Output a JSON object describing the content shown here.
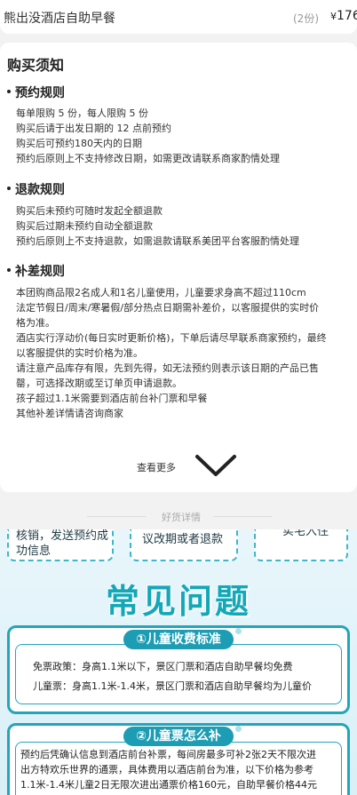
{
  "item": {
    "name": "熊出没酒店自助早餐",
    "count": "(2份)",
    "currency": "¥",
    "price": "176"
  },
  "notice": {
    "title": "购买须知",
    "sections": [
      {
        "title": "预约规则",
        "lines": [
          "每单限购 5 份，每人限购 5 份",
          "购买后请于出发日期的 12 点前预约",
          "购买后可预约180天内的日期",
          "预约后原则上不支持修改日期，如需更改请联系商家酌情处理"
        ]
      },
      {
        "title": "退款规则",
        "lines": [
          "购买后未预约可随时发起全额退款",
          "购买后过期未预约自动全额退款",
          "预约后原则上不支持退款，如需退款请联系美团平台客服酌情处理"
        ]
      },
      {
        "title": "补差规则",
        "lines": [
          "本团购商品限2名成人和1名儿童使用，儿童要求身高不超过110cm",
          "法定节假日/周末/寒暑假/部分热点日期需补差价，以客服提供的实时价",
          "格为准。",
          "酒店实行浮动价(每日实时更新价格)，下单后请尽早联系商家预约，最终",
          "以客服提供的实时价格为准。",
          "请注意产品库存有限，先到先得，如无法预约则表示该日期的产品已售",
          "罄，可选择改期或至订单页申请退款。",
          "孩子超过1.1米需要到酒店前台补门票和早餐",
          "其他补差详情请咨询商家"
        ]
      }
    ],
    "more_label": "查看更多"
  },
  "divider_label": "好货详情",
  "promo": {
    "box_left_lines": [
      "核销，发送预约成",
      "功信息"
    ],
    "box_mid_line": "议改期或者退款",
    "box_right_line": "实宅入住",
    "faq_title": "常见问题",
    "card1": {
      "pill": "①儿童收费标准",
      "lines": [
        "免票政策：身高1.1米以下，景区门票和酒店自助早餐均免费",
        "儿童票：身高1.1米-1.4米，景区门票和酒店自助早餐均为儿童价"
      ]
    },
    "card2": {
      "pill": "②儿童票怎么补",
      "lines": [
        "预约后凭确认信息到酒店前台补票，每间房最多可补2张2天不限次进",
        "出方特欢乐世界的通票，具体费用以酒店前台为准，以下价格为参考",
        "1.1米-1.4米儿童2日无限次进出通票价格160元，自助早餐价格44元"
      ]
    }
  },
  "colors": {
    "accent": "#13a8b8",
    "pill": "#1c9db3",
    "border": "#26a4b8"
  }
}
